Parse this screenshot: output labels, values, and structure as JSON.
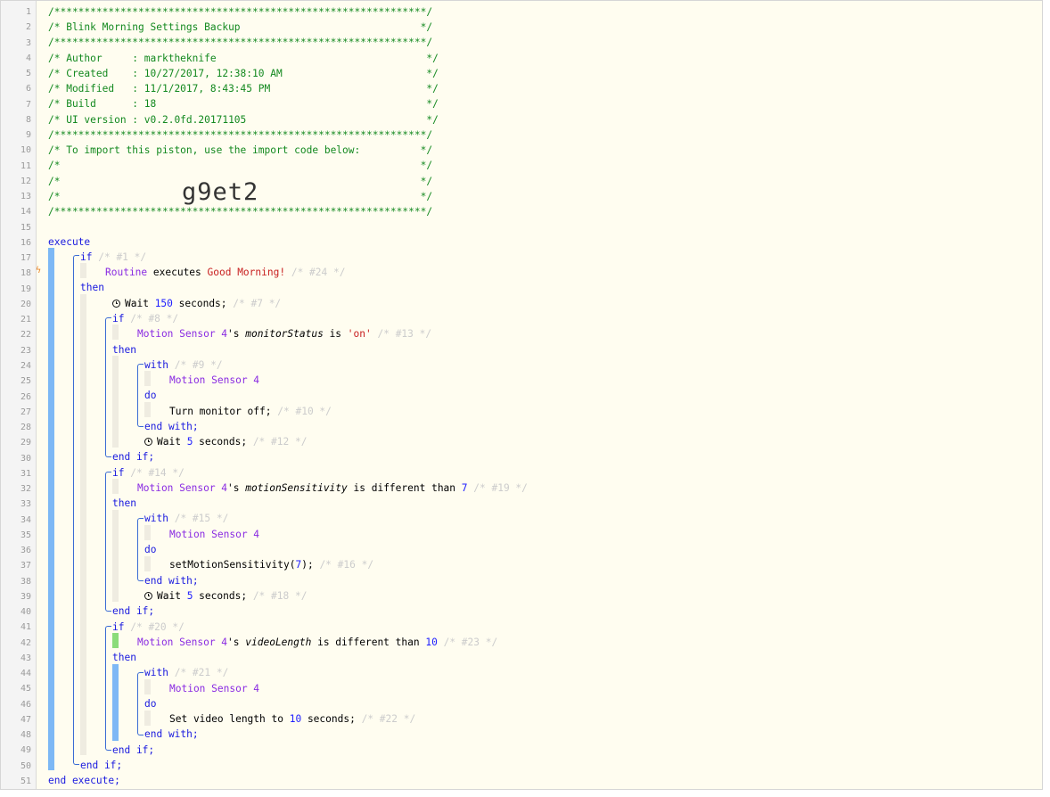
{
  "lines": {
    "l1": "/**************************************************************/",
    "l2": "/* Blink Morning Settings Backup                              */",
    "l3": "/**************************************************************/",
    "l4": "/* Author     : marktheknife                                   */",
    "l5": "/* Created    : 10/27/2017, 12:38:10 AM                        */",
    "l6": "/* Modified   : 11/1/2017, 8:43:45 PM                          */",
    "l7": "/* Build      : 18                                             */",
    "l8": "/* UI version : v0.2.0fd.20171105                              */",
    "l9": "/**************************************************************/",
    "l10": "/* To import this piston, use the import code below:          */",
    "l11": "/*                                                            */",
    "l12": "/*                                                            */",
    "l13": "/*                                                            */",
    "l14": "/**************************************************************/"
  },
  "import_code": "g9et2",
  "kw": {
    "execute": "execute",
    "end_execute": "end execute;",
    "if": "if",
    "then": "then",
    "with": "with",
    "do": "do",
    "end_with": "end with;",
    "end_if": "end if;"
  },
  "ids": {
    "c1": "/* #1 */",
    "c24": "/* #24 */",
    "c7": "/* #7 */",
    "c8": "/* #8 */",
    "c13": "/* #13 */",
    "c9": "/* #9 */",
    "c10": "/* #10 */",
    "c12": "/* #12 */",
    "c14": "/* #14 */",
    "c19": "/* #19 */",
    "c15": "/* #15 */",
    "c16": "/* #16 */",
    "c18": "/* #18 */",
    "c20": "/* #20 */",
    "c23": "/* #23 */",
    "c21": "/* #21 */",
    "c22": "/* #22 */"
  },
  "trigger": {
    "device": "Routine",
    "verb": " executes ",
    "value": "Good Morning!"
  },
  "wait1": {
    "pre": "Wait ",
    "num": "150",
    "post": " seconds;"
  },
  "cond1": {
    "device": "Motion Sensor 4",
    "poss": "'s ",
    "attr": "monitorStatus",
    "op": " is ",
    "value": "'on'"
  },
  "with1": {
    "device": "Motion Sensor 4",
    "action": "Turn monitor off;"
  },
  "wait2": {
    "pre": "Wait ",
    "num": "5",
    "post": " seconds;"
  },
  "cond2": {
    "device": "Motion Sensor 4",
    "poss": "'s ",
    "attr": "motionSensitivity",
    "op": " is different than ",
    "value": "7"
  },
  "with2": {
    "device": "Motion Sensor 4",
    "action_pre": "setMotionSensitivity(",
    "num": "7",
    "action_post": ");"
  },
  "wait3": {
    "pre": "Wait ",
    "num": "5",
    "post": " seconds;"
  },
  "cond3": {
    "device": "Motion Sensor 4",
    "poss": "'s ",
    "attr": "videoLength",
    "op": " is different than ",
    "value": "10"
  },
  "with3": {
    "device": "Motion Sensor 4",
    "action_pre": "Set video length to ",
    "num": "10",
    "action_post": " seconds;"
  },
  "line_count": 51,
  "colors": {
    "comment": "#13891f",
    "keyword": "#1a1adf",
    "device": "#8a2be2",
    "string": "#c82020",
    "number": "#2020ff",
    "active_bar": "#7db8f5",
    "true_bar": "#8adc7a"
  },
  "icons": {
    "wait": "clock-icon",
    "trigger": "lightning-icon"
  }
}
